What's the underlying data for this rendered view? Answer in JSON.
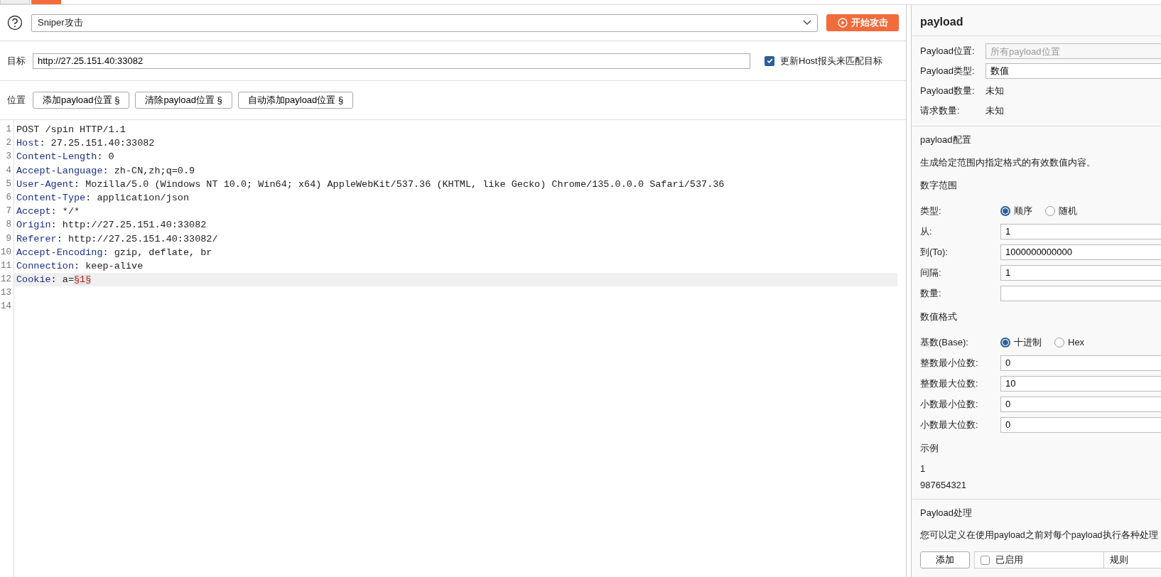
{
  "attack": {
    "attack_type": "Sniper攻击",
    "start_button": "开始攻击"
  },
  "target": {
    "label": "目标",
    "value": "http://27.25.151.40:33082",
    "update_host": {
      "label": "更新Host报头来匹配目标",
      "checked": true
    }
  },
  "positions": {
    "label": "位置",
    "buttons": [
      "添加payload位置 §",
      "清除payload位置 §",
      "自动添加payload位置 §"
    ]
  },
  "editor": {
    "lines": [
      {
        "number": "1",
        "current": false,
        "segments": [
          {
            "kind": "plain",
            "text": "POST /spin HTTP/1.1"
          }
        ]
      },
      {
        "number": "2",
        "current": false,
        "segments": [
          {
            "kind": "header",
            "text": "Host"
          },
          {
            "kind": "plain",
            "text": ": 27.25.151.40:33082"
          }
        ]
      },
      {
        "number": "3",
        "current": false,
        "segments": [
          {
            "kind": "header",
            "text": "Content-Length"
          },
          {
            "kind": "plain",
            "text": ": 0"
          }
        ]
      },
      {
        "number": "4",
        "current": false,
        "segments": [
          {
            "kind": "header",
            "text": "Accept-Language"
          },
          {
            "kind": "plain",
            "text": ": zh-CN,zh;q=0.9"
          }
        ]
      },
      {
        "number": "5",
        "current": false,
        "segments": [
          {
            "kind": "header",
            "text": "User-Agent"
          },
          {
            "kind": "plain",
            "text": ": Mozilla/5.0 (Windows NT 10.0; Win64; x64) AppleWebKit/537.36 (KHTML, like Gecko) Chrome/135.0.0.0 Safari/537.36"
          }
        ]
      },
      {
        "number": "6",
        "current": false,
        "segments": [
          {
            "kind": "header",
            "text": "Content-Type"
          },
          {
            "kind": "plain",
            "text": ": application/json"
          }
        ]
      },
      {
        "number": "7",
        "current": false,
        "segments": [
          {
            "kind": "header",
            "text": "Accept"
          },
          {
            "kind": "plain",
            "text": ": */*"
          }
        ]
      },
      {
        "number": "8",
        "current": false,
        "segments": [
          {
            "kind": "header",
            "text": "Origin"
          },
          {
            "kind": "plain",
            "text": ": http://27.25.151.40:33082"
          }
        ]
      },
      {
        "number": "9",
        "current": false,
        "segments": [
          {
            "kind": "header",
            "text": "Referer"
          },
          {
            "kind": "plain",
            "text": ": http://27.25.151.40:33082/"
          }
        ]
      },
      {
        "number": "10",
        "current": false,
        "segments": [
          {
            "kind": "header",
            "text": "Accept-Encoding"
          },
          {
            "kind": "plain",
            "text": ": gzip, deflate, br"
          }
        ]
      },
      {
        "number": "11",
        "current": false,
        "segments": [
          {
            "kind": "header",
            "text": "Connection"
          },
          {
            "kind": "plain",
            "text": ": keep-alive"
          }
        ]
      },
      {
        "number": "12",
        "current": true,
        "segments": [
          {
            "kind": "header",
            "text": "Cookie"
          },
          {
            "kind": "plain",
            "text": ": a="
          },
          {
            "kind": "payload",
            "text": "§1§"
          }
        ]
      },
      {
        "number": "13",
        "current": false
      },
      {
        "number": "14",
        "current": false
      }
    ]
  },
  "payload_panel": {
    "title": "payload",
    "summary": [
      {
        "label": "Payload位置:",
        "kind": "field",
        "placeholder": "所有payload位置"
      },
      {
        "label": "Payload类型:",
        "kind": "field",
        "value": "数值"
      },
      {
        "label": "Payload数量:",
        "kind": "text",
        "value": "未知"
      },
      {
        "label": "请求数量:",
        "kind": "text",
        "value": "未知"
      }
    ],
    "config_title": "payload配置",
    "config_description": "生成给定范围内指定格式的有效数值内容。",
    "groups": [
      {
        "title": "数字范围",
        "rows": [
          {
            "label": "类型:",
            "kind": "radio",
            "options": [
              {
                "label": "顺序",
                "selected": true
              },
              {
                "label": "随机",
                "selected": false
              }
            ]
          },
          {
            "label": "从:",
            "kind": "field",
            "value": "1"
          },
          {
            "label": "到(To):",
            "kind": "field",
            "value": "1000000000000"
          },
          {
            "label": "间隔:",
            "kind": "field",
            "value": "1"
          },
          {
            "label": "数量:",
            "kind": "field"
          }
        ]
      },
      {
        "title": "数值格式",
        "rows": [
          {
            "label": "基数(Base):",
            "kind": "radio",
            "options": [
              {
                "label": "十进制",
                "selected": true
              },
              {
                "label": "Hex",
                "selected": false
              }
            ]
          },
          {
            "label": "整数最小位数:",
            "kind": "field",
            "value": "0"
          },
          {
            "label": "整数最大位数:",
            "kind": "field",
            "value": "10"
          },
          {
            "label": "小数最小位数:",
            "kind": "field",
            "value": "0"
          },
          {
            "label": "小数最大位数:",
            "kind": "field",
            "value": "0"
          }
        ]
      }
    ],
    "examples_title": "示例",
    "examples": [
      "1",
      "987654321"
    ],
    "processing": {
      "title": "Payload处理",
      "description": "您可以定义在使用payload之前对每个payload执行各种处理",
      "add_button": "添加",
      "columns": [
        {
          "label": "已启用",
          "kind": "checkbox",
          "checked": false
        },
        {
          "label": "规则",
          "kind": "text"
        }
      ]
    }
  }
}
